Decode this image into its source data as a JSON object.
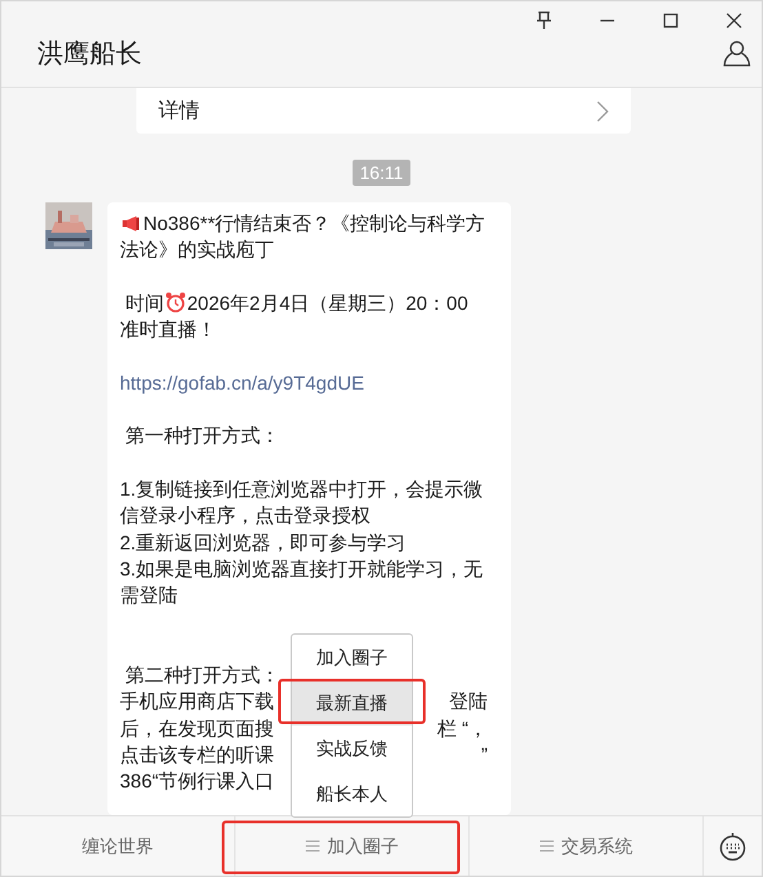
{
  "window": {
    "title": "洪鹰船长"
  },
  "details_card": {
    "label": "详情"
  },
  "timestamp": "16:11",
  "message": {
    "blocks": [
      {
        "kind": "icon_text",
        "after": "No386**行情结束否？《控制论与科学方",
        "more_lines": [
          "法论》的实战庖丁"
        ]
      },
      {
        "kind": "icon_text",
        "before": " 时间",
        "after": "2026年2月4日（星期三）20：00",
        "more_lines": [
          "准时直播！"
        ]
      },
      {
        "kind": "link",
        "lines": [
          "https://gofab.cn/a/y9T4gdUE"
        ]
      },
      {
        "kind": "text",
        "lines": [
          " 第一种打开方式："
        ]
      },
      {
        "kind": "text",
        "lines": [
          "1.复制链接到任意浏览器中打开，会提示微信登录小程序，点击登录授权",
          "2.重新返回浏览器，即可参与学习",
          "3.如果是电脑浏览器直接打开就能学习，无需登陆"
        ]
      },
      {
        "kind": "covered",
        "lines": [
          {
            "left": " 第二种打开方式："
          },
          {
            "left": "手机应用商店下载",
            "right": "登陆"
          },
          {
            "left": "后，在发现页面搜",
            "right": "栏 “，"
          },
          {
            "left": "点击该专栏的听课",
            "right": "”"
          },
          {
            "left": "386“节例行课入口"
          }
        ]
      }
    ]
  },
  "popup_menu": [
    {
      "label": "加入圈子",
      "selected": false,
      "highlighted": false
    },
    {
      "label": "最新直播",
      "selected": true,
      "highlighted": true
    },
    {
      "label": "实战反馈",
      "selected": false,
      "highlighted": false
    },
    {
      "label": "船长本人",
      "selected": false,
      "highlighted": false
    }
  ],
  "bottom_menu": [
    {
      "label": "缠论世界",
      "has_submenu": false,
      "highlighted": false
    },
    {
      "label": "加入圈子",
      "has_submenu": true,
      "highlighted": true
    },
    {
      "label": "交易系统",
      "has_submenu": true,
      "highlighted": false
    }
  ]
}
